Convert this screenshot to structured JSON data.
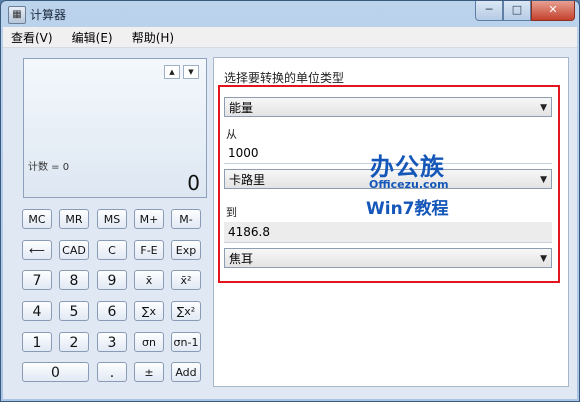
{
  "window": {
    "title": "计算器",
    "min": "─",
    "max": "□",
    "close": "✕",
    "icon": "▦"
  },
  "menu": [
    "查看(V)",
    "编辑(E)",
    "帮助(H)"
  ],
  "display": {
    "up": "▲",
    "down": "▼",
    "counter": "计数 = 0",
    "value": "0"
  },
  "buttons": {
    "mc": "MC",
    "mr": "MR",
    "ms": "MS",
    "mplus": "M+",
    "mminus": "M-",
    "back": "⟵",
    "cad": "CAD",
    "c": "C",
    "fe": "F-E",
    "exp": "Exp",
    "n7": "7",
    "n8": "8",
    "n9": "9",
    "mean": "x̄",
    "meansq": "x̄²",
    "n4": "4",
    "n5": "5",
    "n6": "6",
    "sum": "∑x",
    "sumsq": "∑x²",
    "n1": "1",
    "n2": "2",
    "n3": "3",
    "sdn": "σn",
    "sdn1": "σn-1",
    "n0": "0",
    "dot": ".",
    "pm": "±",
    "add": "Add"
  },
  "converter": {
    "title": "选择要转换的单位类型",
    "type": "能量",
    "from_label": "从",
    "from_value": "1000",
    "from_unit": "卡路里",
    "to_label": "到",
    "to_value": "4186.8",
    "to_unit": "焦耳",
    "dropdown_arrow": "▼"
  },
  "watermark": {
    "line1": "办公族",
    "line2": "Officezu.com",
    "line3": "Win7教程"
  }
}
